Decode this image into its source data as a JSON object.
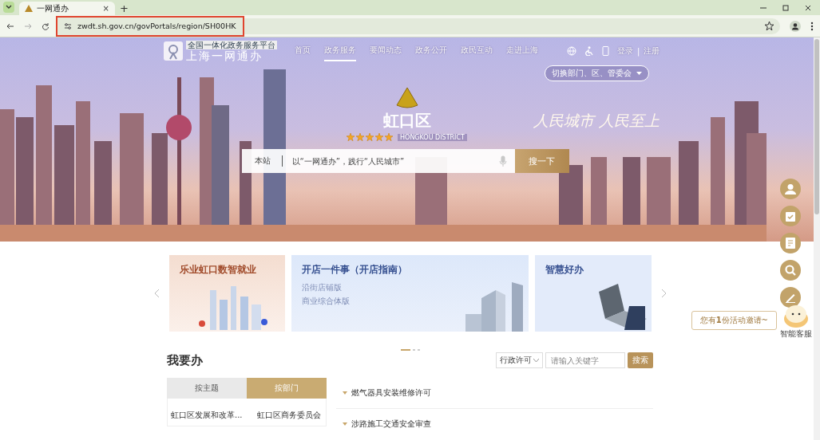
{
  "browser": {
    "tab_title": "一网通办",
    "tab_close": "×",
    "new_tab": "+",
    "url": "zwdt.sh.gov.cn/govPortals/region/SH00HK",
    "url_highlighted": true
  },
  "header": {
    "logo_tagline": "全国一体化政务服务平台",
    "logo_name": "上海一网通办",
    "nav": [
      {
        "label": "首页",
        "selected": false
      },
      {
        "label": "政务服务",
        "selected": true
      },
      {
        "label": "要闻动态",
        "selected": false
      },
      {
        "label": "政务公开",
        "selected": false
      },
      {
        "label": "政民互动",
        "selected": false
      },
      {
        "label": "走进上海",
        "selected": false
      }
    ],
    "login": "登录",
    "separator": "|",
    "register": "注册",
    "switch_dropdown": "切换部门、区、管委会"
  },
  "hero": {
    "district": "虹口区",
    "stars": 5,
    "subtitle": "HONGKOU DISTRICT",
    "slogan": "人民城市  人民至上",
    "search": {
      "scope": "本站",
      "placeholder": "以“一网通办”，践行“人民城市”",
      "button": "搜一下"
    }
  },
  "cards": [
    {
      "title": "乐业虹口数智就业",
      "kind": "employment"
    },
    {
      "title": "开店一件事（开店指南）",
      "links": [
        "沿街店铺版",
        "商业综合体版"
      ],
      "kind": "shop"
    },
    {
      "title": "智慧好办",
      "kind": "smart"
    }
  ],
  "carousel_dots": [
    {
      "selected": true
    },
    {
      "selected": false
    },
    {
      "selected": false
    }
  ],
  "todo": {
    "title": "我要办",
    "filter": "行政许可",
    "keyword_placeholder": "请输入关键字",
    "search_button": "搜索",
    "tabs": [
      {
        "label": "按主题",
        "selected": false
      },
      {
        "label": "按部门",
        "selected": true
      }
    ],
    "departments": [
      "虹口区发展和改革...",
      "虹口区商务委员会"
    ],
    "items": [
      "燃气器具安装维修许可",
      "涉路施工交通安全审查"
    ]
  },
  "float_tools": [
    {
      "kind": "user"
    },
    {
      "kind": "calendar"
    },
    {
      "kind": "note"
    },
    {
      "kind": "search"
    },
    {
      "kind": "pen"
    }
  ],
  "invite": {
    "text": "您有**1**份活动邀请~",
    "assistant": "智能客服"
  }
}
